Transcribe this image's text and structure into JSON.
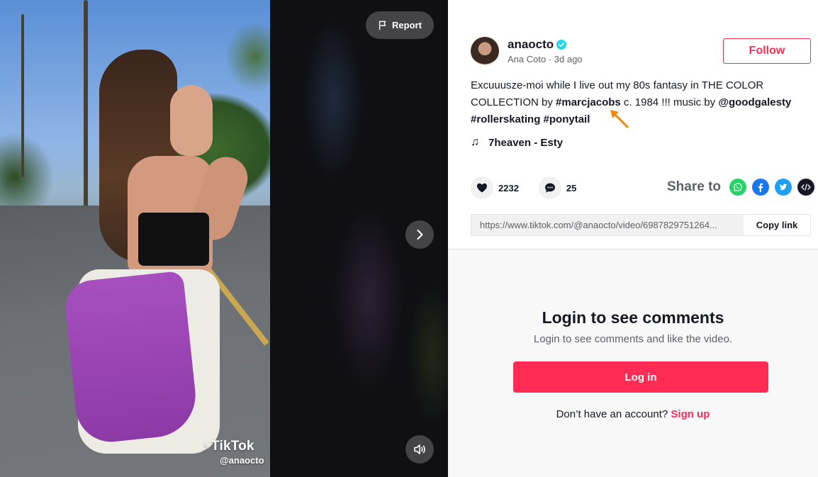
{
  "video": {
    "report_label": "Report",
    "watermark_logo_text": "TikTok",
    "watermark_handle": "@anaocto"
  },
  "author": {
    "username": "anaocto",
    "display_name": "Ana Coto",
    "separator": " · ",
    "posted": "3d ago",
    "verified": true
  },
  "follow_label": "Follow",
  "caption": {
    "text_1": "Excuuusze-moi while I live out my 80s fantasy in THE COLOR COLLECTION by ",
    "tag_1": "#marcjacobs",
    "text_2": " c. 1984 !!! music by ",
    "mention_1": "@goodgalesty",
    "text_3": " ",
    "tag_2": "#rollerskating",
    "text_4": " ",
    "tag_3": "#ponytail"
  },
  "music": {
    "title": "7heaven - Esty",
    "icon": "music-note-icon"
  },
  "stats": {
    "likes": "2232",
    "comments": "25"
  },
  "share": {
    "label": "Share to",
    "targets": [
      "whatsapp-icon",
      "facebook-icon",
      "twitter-icon",
      "embed-icon"
    ]
  },
  "link": {
    "url": "https://www.tiktok.com/@anaocto/video/6987829751264...",
    "copy_label": "Copy link"
  },
  "comments_login": {
    "title": "Login to see comments",
    "subtitle": "Login to see comments and like the video.",
    "login_button": "Log in",
    "no_account_text": "Don’t have an account?",
    "signup_link": "Sign up"
  },
  "colors": {
    "accent": "#fe2c55",
    "verified": "#20d5ec",
    "whatsapp": "#25d366",
    "facebook": "#1877f2",
    "twitter": "#1da1f2",
    "embed": "#161823",
    "cursor": "#f2870d"
  }
}
